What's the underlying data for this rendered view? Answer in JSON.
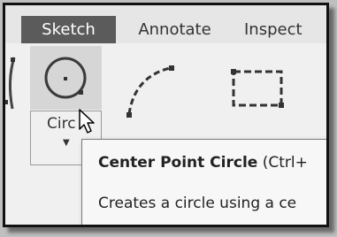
{
  "tabs": [
    {
      "label": "Sketch",
      "active": true
    },
    {
      "label": "Annotate",
      "active": false
    },
    {
      "label": "Inspect",
      "active": false
    }
  ],
  "ribbon": {
    "circle_tool": {
      "label": "Circ",
      "icon": "center-point-circle-icon",
      "has_dropdown": true
    },
    "other_tools": [
      "arc-icon",
      "rectangle-icon"
    ]
  },
  "tooltip": {
    "title": "Center Point Circle",
    "shortcut": " (Ctrl+",
    "description": "Creates a circle using a ce"
  },
  "colors": {
    "active_tab_bg": "#5b5b5b",
    "hover_button_bg": "#d6d6d6",
    "tooltip_bg": "#f7f7f7"
  }
}
